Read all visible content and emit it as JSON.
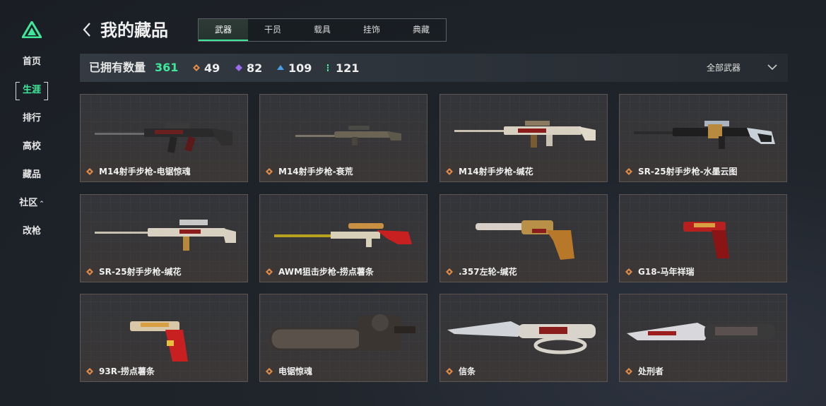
{
  "sidebar": {
    "items": [
      {
        "label": "首页"
      },
      {
        "label": "生涯"
      },
      {
        "label": "排行"
      },
      {
        "label": "高校"
      },
      {
        "label": "藏品"
      },
      {
        "label": "社区"
      },
      {
        "label": "改枪"
      }
    ],
    "active": "生涯",
    "accent": "#3ee89a"
  },
  "header": {
    "title": "我的藏品"
  },
  "tabs": [
    {
      "label": "武器"
    },
    {
      "label": "干员"
    },
    {
      "label": "载具"
    },
    {
      "label": "挂饰"
    },
    {
      "label": "典藏"
    }
  ],
  "active_tab": "武器",
  "stats": {
    "owned_label": "已拥有数量",
    "owned_count": "361",
    "orange_count": "49",
    "purple_count": "82",
    "blue_count": "109",
    "green_count": "121"
  },
  "filter": {
    "label": "全部武器"
  },
  "items": [
    {
      "name": "M14射手步枪-电锯惊魂",
      "icon": "rifle-icon"
    },
    {
      "name": "M14射手步枪-衰荒",
      "icon": "rifle-icon"
    },
    {
      "name": "M14射手步枪-缄花",
      "icon": "rifle-icon"
    },
    {
      "name": "SR-25射手步枪-水墨云图",
      "icon": "rifle-icon"
    },
    {
      "name": "SR-25射手步枪-缄花",
      "icon": "rifle-icon"
    },
    {
      "name": "AWM狙击步枪-捞点薯条",
      "icon": "sniper-icon"
    },
    {
      "name": ".357左轮-缄花",
      "icon": "revolver-icon"
    },
    {
      "name": "G18-马年祥瑞",
      "icon": "pistol-icon"
    },
    {
      "name": "93R-捞点薯条",
      "icon": "pistol-icon"
    },
    {
      "name": "电锯惊魂",
      "icon": "chainsaw-icon"
    },
    {
      "name": "信条",
      "icon": "knife-icon"
    },
    {
      "name": "处刑者",
      "icon": "knife-icon"
    }
  ],
  "colors": {
    "rarity_orange": "#e08a4a",
    "rarity_purple": "#9a6cf0",
    "rarity_blue": "#4a9ee8",
    "rarity_green": "#3ee89a"
  }
}
